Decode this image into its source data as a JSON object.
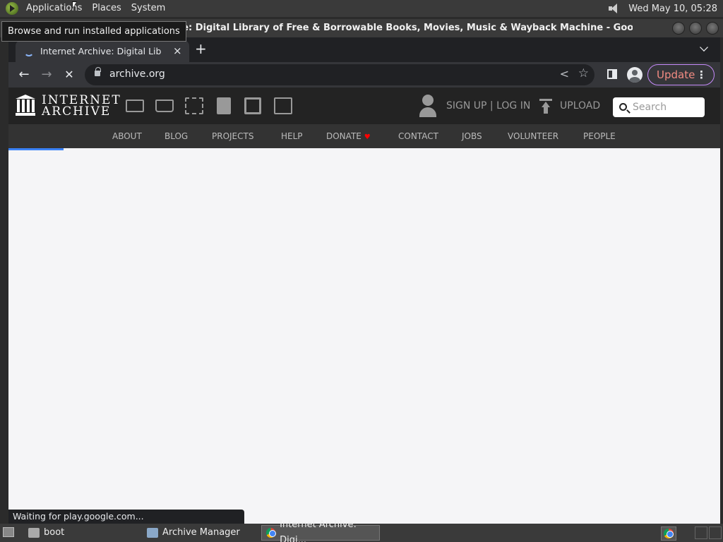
{
  "top_panel": {
    "menus": [
      "Applications",
      "Places",
      "System"
    ],
    "clock": "Wed May 10, 05:28"
  },
  "tooltip": "Browse and run installed applications",
  "window": {
    "title": "hive: Digital Library of Free & Borrowable Books, Movies, Music & Wayback Machine - Google Chrome"
  },
  "tab": {
    "label": "Internet Archive: Digital Library",
    "close": "×",
    "new": "+"
  },
  "toolbar": {
    "back": "←",
    "forward": "→",
    "stop": "✕",
    "url": "archive.org",
    "share": "<",
    "star": "☆",
    "update_label": "Update",
    "menu_dots": "⋮"
  },
  "ia": {
    "wordmark_line1": "INTERNET",
    "wordmark_line2": "ARCHIVE",
    "signup": "SIGN UP | LOG IN",
    "upload": "UPLOAD",
    "search_placeholder": "Search",
    "nav": [
      "ABOUT",
      "BLOG",
      "PROJECTS",
      "HELP",
      "DONATE",
      "CONTACT",
      "JOBS",
      "VOLUNTEER",
      "PEOPLE"
    ],
    "donate_heart": "♥",
    "media_icons": [
      "web-icon",
      "texts-icon",
      "video-icon",
      "audio-icon",
      "software-icon",
      "images-icon"
    ]
  },
  "status": "Waiting for play.google.com...",
  "bottom_panel": {
    "tasks": [
      "boot",
      "Archive Manager",
      "Internet Archive: Digi..."
    ]
  },
  "colors": {
    "accent_progress": "#3b82f6",
    "update_text": "#f28b82",
    "update_border": "#c58af9",
    "heart": "#ff0000"
  }
}
